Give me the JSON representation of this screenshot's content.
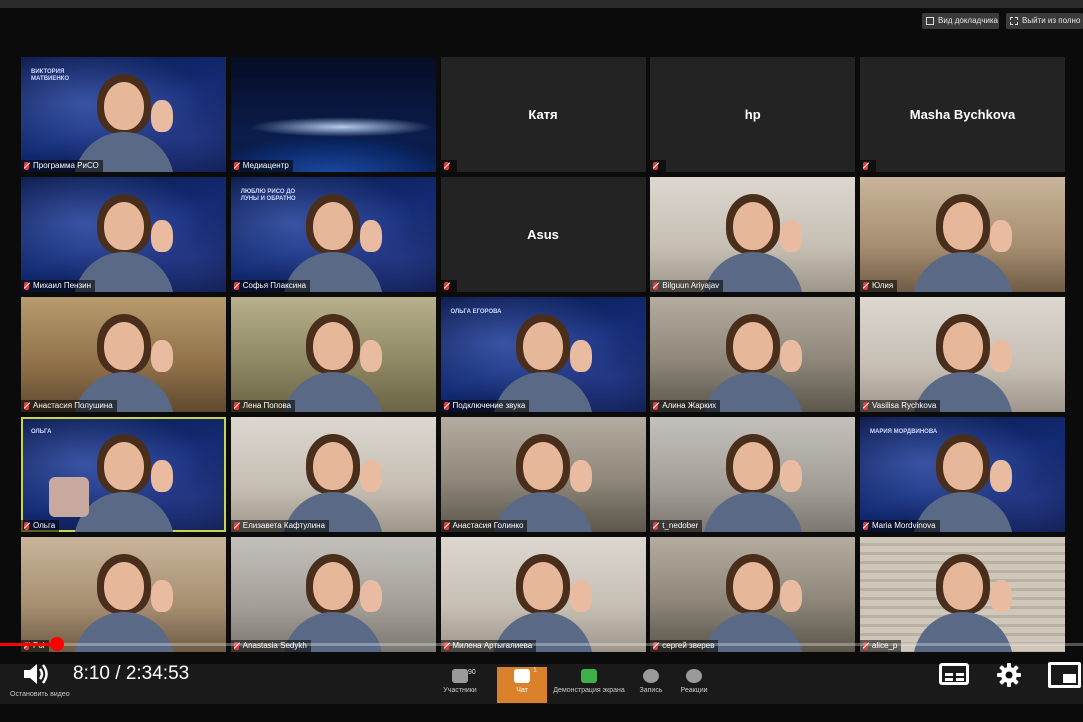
{
  "meeting": {
    "view_button": "Вид докладчика",
    "exit_button": "Выйти из полно",
    "participants": [
      {
        "name": "Программа РиСО",
        "bg": "space",
        "badge": "ВИКТОРИЯ МАТВИЕНКО",
        "person": true
      },
      {
        "name": "Медиацентр",
        "bg": "earth",
        "person": false
      },
      {
        "name": "",
        "center": "Катя",
        "bg": "dark"
      },
      {
        "name": "",
        "center": "hp",
        "bg": "dark"
      },
      {
        "name": "",
        "center": "Masha Bychkova",
        "bg": "dark"
      },
      {
        "name": "Михаил Пензин",
        "bg": "space",
        "person": true
      },
      {
        "name": "Софья Плаксина",
        "bg": "space",
        "badge": "ЛЮБЛЮ РИСО ДО ЛУНЫ И ОБРАТНО",
        "person": true
      },
      {
        "name": "",
        "center": "Asus",
        "bg": "dark"
      },
      {
        "name": "Bilguun Ariyajav",
        "bg": "room-light",
        "person": true
      },
      {
        "name": "Юлия",
        "bg": "room-warm",
        "person": true
      },
      {
        "name": "Анастасия Полушина",
        "bg": "room-wood",
        "person": true
      },
      {
        "name": "Лена Попова",
        "bg": "room-green",
        "person": true
      },
      {
        "name": "Подключение звука",
        "bg": "space",
        "badge": "ОЛЬГА ЕГОРОВА",
        "person": true
      },
      {
        "name": "Алина Жарких",
        "bg": "room-shelf",
        "person": true
      },
      {
        "name": "Vasilisa Rychkova",
        "bg": "room-light",
        "person": true
      },
      {
        "name": "Ольга",
        "bg": "space",
        "badge": "ОЛЬГА",
        "person": true,
        "active": true
      },
      {
        "name": "Елизавета Кафтулина",
        "bg": "room-light",
        "person": true
      },
      {
        "name": "Анастасия Голинко",
        "bg": "room-shelf",
        "person": true
      },
      {
        "name": "t_nedober",
        "bg": "room-gray",
        "person": true
      },
      {
        "name": "Maria Mordvinova",
        "bg": "space",
        "badge": "МАРИЯ МОРДВИНОВА",
        "person": true
      },
      {
        "name": "Pol",
        "bg": "room-warm",
        "person": true
      },
      {
        "name": "Anastasia Sedykh",
        "bg": "room-gray",
        "person": true
      },
      {
        "name": "Милена Артыгалиева",
        "bg": "room-light",
        "person": true
      },
      {
        "name": "сергей зверев",
        "bg": "room-shelf",
        "person": true
      },
      {
        "name": "alice_p",
        "bg": "room-blinds",
        "person": true
      }
    ]
  },
  "zoom_toolbar": {
    "stop_video": "Остановить видео",
    "participants_label": "Участники",
    "participants_count": "90",
    "chat_label": "Чат",
    "chat_count": "1",
    "share_label": "Демонстрация экрана",
    "record_label": "Запись",
    "reactions_label": "Реакции"
  },
  "player": {
    "current_time": "8:10",
    "duration": "2:34:53",
    "time_text": "8:10 / 2:34:53",
    "progress_fraction": 0.0527
  },
  "colors": {
    "progress": "#ff0000",
    "active_speaker": "#c9d34d",
    "chat_highlight": "#d9822b"
  }
}
